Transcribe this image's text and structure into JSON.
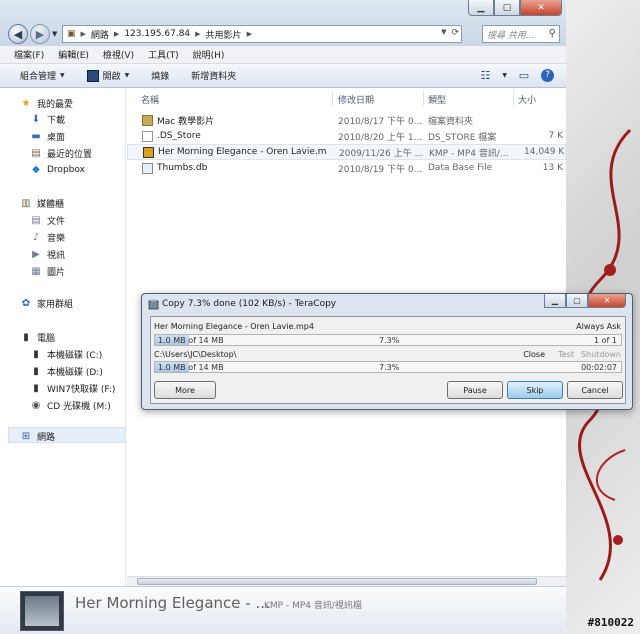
{
  "address": {
    "crumbs": [
      "網路",
      "123.195.67.84",
      "共用影片"
    ]
  },
  "search": {
    "placeholder": "搜尋 共用..."
  },
  "menu": [
    "檔案(F)",
    "編輯(E)",
    "檢視(V)",
    "工具(T)",
    "說明(H)"
  ],
  "toolbar": {
    "organize": "組合管理",
    "open": "開啟",
    "burn": "燒錄",
    "new_folder": "新增資料夾"
  },
  "nav": {
    "favorites": "我的最愛",
    "fav_items": [
      "下載",
      "桌面",
      "最近的位置",
      "Dropbox"
    ],
    "libraries": "媒體櫃",
    "lib_items": [
      "文件",
      "音樂",
      "視訊",
      "圖片"
    ],
    "homegroup": "家用群組",
    "computer": "電腦",
    "comp_items": [
      "本機磁碟 (C:)",
      "本機磁碟 (D:)",
      "WIN7快取碟 (F:)",
      "CD 光碟機 (M:)"
    ],
    "network": "網路"
  },
  "columns": {
    "name": "名稱",
    "date": "修改日期",
    "type": "類型",
    "size": "大小"
  },
  "files": [
    {
      "name": "Mac 教學影片",
      "date": "2010/8/17 下午 0...",
      "type": "檔案資料夾",
      "size": ""
    },
    {
      "name": ".DS_Store",
      "date": "2010/8/20 上午 1...",
      "type": "DS_STORE 檔案",
      "size": "7 K"
    },
    {
      "name": "Her Morning Elegance - Oren Lavie.m...",
      "date": "2009/11/26 上午 ...",
      "type": "KMP - MP4 音訊/...",
      "size": "14,049 K"
    },
    {
      "name": "Thumbs.db",
      "date": "2010/8/19 下午 0...",
      "type": "Data Base File",
      "size": "13 K"
    }
  ],
  "details": {
    "title": "Her Morning Elegance - ...",
    "type": "KMP - MP4 音訊/視訊檔"
  },
  "watermark": "#810022",
  "teracopy": {
    "title": "Copy 7.3% done (102 KB/s) - TeraCopy",
    "file_name": "Her Morning Elegance - Oren Lavie.mp4",
    "always_ask": "Always Ask",
    "file_progress": {
      "label": "1.0 MB of 14 MB",
      "percent": "7.3%",
      "fraction": 0.073,
      "right": "1 of 1"
    },
    "target": "C:\\Users\\JC\\Desktop\\",
    "opt_close": "Close",
    "opt_test": "Test",
    "opt_shutdown": "Shutdown",
    "total_progress": {
      "label": "1.0 MB of 14 MB",
      "percent": "7.3%",
      "fraction": 0.073,
      "right": "00:02:07"
    },
    "buttons": {
      "more": "More",
      "pause": "Pause",
      "skip": "Skip",
      "cancel": "Cancel"
    }
  }
}
